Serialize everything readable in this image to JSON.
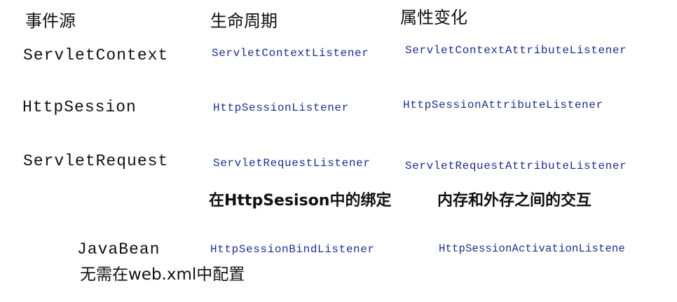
{
  "headers": {
    "event_source": "事件源",
    "lifecycle": "生命周期",
    "attribute_change": "属性变化"
  },
  "rows": [
    {
      "source": "ServletContext",
      "lifecycle_listener": "ServletContextListener",
      "attribute_listener": "ServletContextAttributeListener"
    },
    {
      "source": "HttpSession",
      "lifecycle_listener": "HttpSessionListener",
      "attribute_listener": "HttpSessionAttributeListener"
    },
    {
      "source": "ServletRequest",
      "lifecycle_listener": "ServletRequestListener",
      "attribute_listener": "ServletRequestAttributeListener"
    }
  ],
  "javabean_section": {
    "binding_header": "在HttpSesison中的绑定",
    "activation_header": "内存和外存之间的交互",
    "source": "JavaBean",
    "binding_listener": "HttpSessionBindListener",
    "activation_listener": "HttpSessionActivationListene",
    "config_note": "无需在web.xml中配置"
  }
}
